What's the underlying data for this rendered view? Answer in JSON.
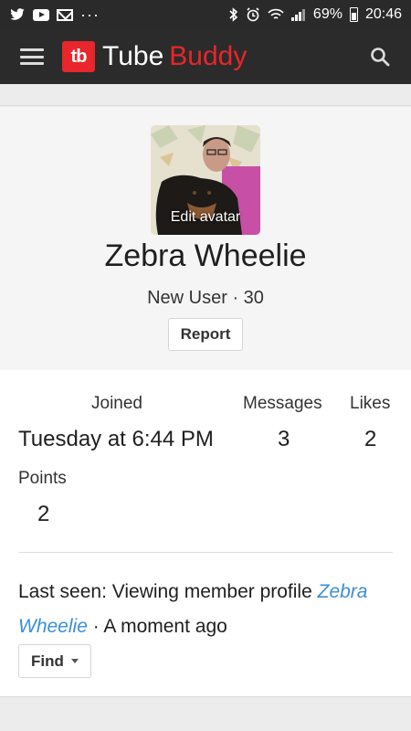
{
  "status_bar": {
    "left_icons": [
      "twitter-icon",
      "youtube-icon",
      "gmail-icon",
      "more-dots-icon"
    ],
    "more": "···",
    "battery": "69%",
    "time": "20:46"
  },
  "app_bar": {
    "logo_mark": "tb",
    "logo_word_1": "Tube",
    "logo_word_2": "Buddy"
  },
  "profile": {
    "avatar_label": "Edit avatar",
    "name": "Zebra Wheelie",
    "meta": "New User · 30",
    "report_label": "Report"
  },
  "stats": {
    "joined_label": "Joined",
    "joined_value": "Tuesday at 6:44 PM",
    "messages_label": "Messages",
    "messages_value": "3",
    "likes_label": "Likes",
    "likes_value": "2",
    "points_label": "Points",
    "points_value": "2"
  },
  "last_seen": {
    "prefix": "Last seen: Viewing member profile",
    "link": "Zebra Wheelie",
    "suffix": "· A moment ago"
  },
  "find": {
    "label": "Find"
  },
  "colors": {
    "brand": "#e8262b",
    "link": "#3b8ed6",
    "appbar": "#2b2b2b"
  }
}
